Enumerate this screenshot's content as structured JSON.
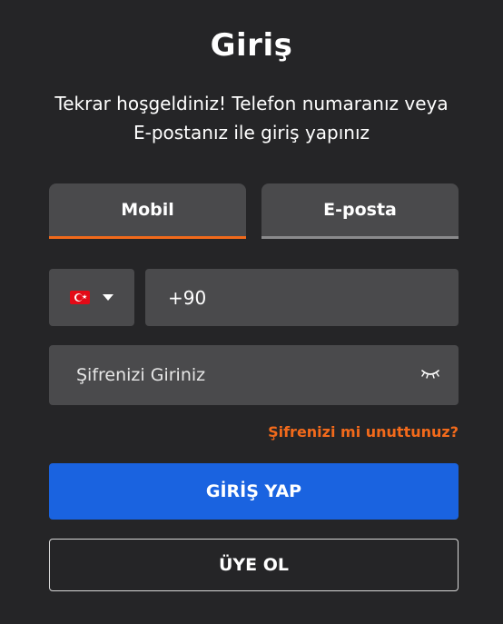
{
  "header": {
    "title": "Giriş",
    "subtitle": "Tekrar hoşgeldiniz! Telefon numaranız veya E-postanız ile giriş yapınız"
  },
  "tabs": [
    {
      "label": "Mobil",
      "active": true
    },
    {
      "label": "E-posta",
      "active": false
    }
  ],
  "phone": {
    "country_flag": "turkey-flag-icon",
    "value": "+90"
  },
  "password": {
    "placeholder": "Şifrenizi Giriniz",
    "toggle_icon": "eye-closed-icon"
  },
  "forgot_label": "Şifrenizi mi unuttunuz?",
  "login_label": "GİRİŞ YAP",
  "register_label": "ÜYE OL",
  "colors": {
    "background": "#252527",
    "field": "#4a4a4c",
    "accent_orange": "#f26a1b",
    "primary_blue": "#1a63e0"
  }
}
